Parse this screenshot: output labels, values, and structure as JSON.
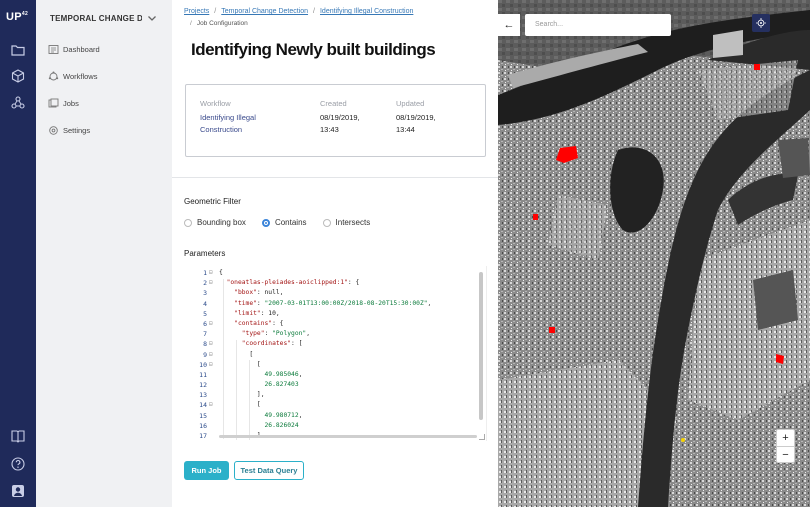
{
  "app": {
    "logo": "UP",
    "logo_sup": "42",
    "project_name": "TEMPORAL CHANGE DETE"
  },
  "sidebar": {
    "items": [
      {
        "label": "Dashboard",
        "icon": "dashboard-icon"
      },
      {
        "label": "Workflows",
        "icon": "workflows-icon"
      },
      {
        "label": "Jobs",
        "icon": "jobs-icon"
      },
      {
        "label": "Settings",
        "icon": "settings-icon"
      }
    ]
  },
  "rail": {
    "icons": [
      "folder-icon",
      "cube-icon",
      "nodes-icon",
      "book-icon",
      "help-icon",
      "user-icon"
    ]
  },
  "breadcrumb": {
    "items": [
      "Projects",
      "Temporal Change Detection",
      "Identifying Illegal Construction"
    ],
    "current": "Job Configuration"
  },
  "page": {
    "title": "Identifying Newly built buildings"
  },
  "info": {
    "workflow_label": "Workflow",
    "workflow_value_1": "Identifying Illegal",
    "workflow_value_2": "Construction",
    "created_label": "Created",
    "created_value_1": "08/19/2019,",
    "created_value_2": "13:43",
    "updated_label": "Updated",
    "updated_value_1": "08/19/2019,",
    "updated_value_2": "13:44"
  },
  "filter": {
    "title": "Geometric Filter",
    "options": [
      "Bounding box",
      "Contains",
      "Intersects"
    ],
    "selected": "Contains"
  },
  "parameters": {
    "title": "Parameters",
    "line_numbers": [
      "1",
      "2",
      "3",
      "4",
      "5",
      "6",
      "7",
      "8",
      "9",
      "10",
      "11",
      "12",
      "13",
      "14",
      "15",
      "16",
      "17"
    ],
    "lines": [
      "{",
      "  \"oneatlas-pleiades-aoiclipped:1\": {",
      "    \"bbox\": null,",
      "    \"time\": \"2007-03-01T13:00:00Z/2018-08-20T15:30:00Z\",",
      "    \"limit\": 10,",
      "    \"contains\": {",
      "      \"type\": \"Polygon\",",
      "      \"coordinates\": [",
      "        [",
      "          [",
      "            49.985046,",
      "            26.827403",
      "          ],",
      "          [",
      "            49.980712,",
      "            26.826024",
      "          ],"
    ]
  },
  "actions": {
    "run_label": "Run Job",
    "test_label": "Test Data Query"
  },
  "map": {
    "search_placeholder": "Search...",
    "back_glyph": "←",
    "zoom_in": "+",
    "zoom_out": "−"
  },
  "colors": {
    "rail": "#1f2a5a",
    "accent": "#2bb0c9",
    "link": "#3778b6",
    "highlight": "#ff0000"
  }
}
